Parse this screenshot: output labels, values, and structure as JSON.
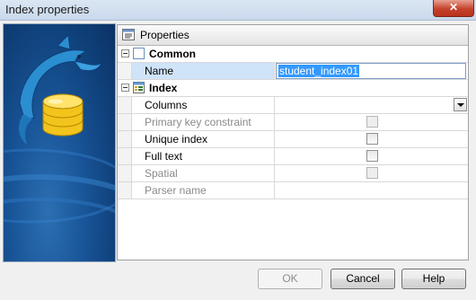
{
  "window": {
    "title": "Index properties",
    "close_glyph": "✕"
  },
  "properties_panel": {
    "header_label": "Properties",
    "header_icon": "properties-icon",
    "categories": [
      {
        "label": "Common",
        "icon": "common-icon",
        "items": [
          {
            "name": "Name",
            "value": "student_index01",
            "type": "text",
            "enabled": true,
            "selected": true
          }
        ]
      },
      {
        "label": "Index",
        "icon": "index-icon",
        "items": [
          {
            "name": "Columns",
            "value": "",
            "type": "dropdown",
            "enabled": true
          },
          {
            "name": "Primary key constraint",
            "type": "checkbox",
            "checked": false,
            "enabled": false
          },
          {
            "name": "Unique index",
            "type": "checkbox",
            "checked": false,
            "enabled": true
          },
          {
            "name": "Full text",
            "type": "checkbox",
            "checked": false,
            "enabled": true
          },
          {
            "name": "Spatial",
            "type": "checkbox",
            "checked": false,
            "enabled": false
          },
          {
            "name": "Parser name",
            "value": "",
            "type": "text",
            "enabled": false
          }
        ]
      }
    ]
  },
  "buttons": {
    "ok": "OK",
    "cancel": "Cancel",
    "help": "Help"
  },
  "colors": {
    "selection": "#3399ff",
    "panel_blue": "#185497"
  }
}
